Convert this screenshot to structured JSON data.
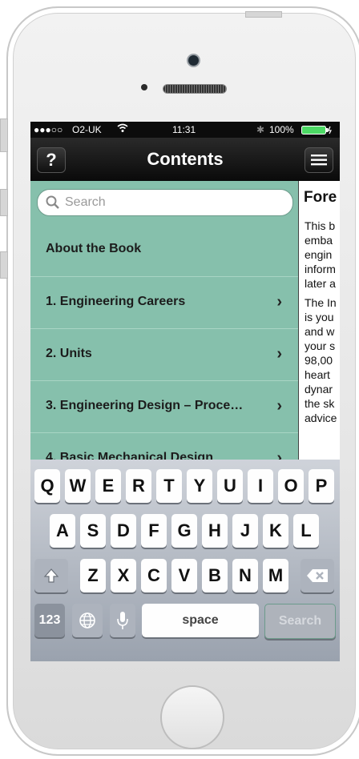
{
  "status": {
    "dots": "●●●○○",
    "carrier": "O2-UK",
    "time": "11:31",
    "battery": "100%"
  },
  "nav": {
    "title": "Contents",
    "help_label": "?",
    "menu_icon": "menu-icon"
  },
  "search": {
    "placeholder": "Search"
  },
  "list": {
    "items": [
      {
        "label": "About the Book",
        "chevron": false
      },
      {
        "label": "1. Engineering Careers",
        "chevron": true
      },
      {
        "label": "2. Units",
        "chevron": true
      },
      {
        "label": "3. Engineering Design – Proce…",
        "chevron": true
      },
      {
        "label": "4. Basic Mechanical Design",
        "chevron": true
      }
    ]
  },
  "preview": {
    "title": "Fore",
    "lines": [
      "This b",
      "emba",
      "engin",
      "inform",
      "later a",
      "The In",
      "is you",
      "and w",
      "your s",
      "98,00",
      "heart",
      "dynar",
      "the sk",
      "advice"
    ]
  },
  "keyboard": {
    "row1": [
      "Q",
      "W",
      "E",
      "R",
      "T",
      "Y",
      "U",
      "I",
      "O",
      "P"
    ],
    "row2": [
      "A",
      "S",
      "D",
      "F",
      "G",
      "H",
      "J",
      "K",
      "L"
    ],
    "row3": [
      "Z",
      "X",
      "C",
      "V",
      "B",
      "N",
      "M"
    ],
    "numbers_label": "123",
    "space_label": "space",
    "search_label": "Search"
  }
}
